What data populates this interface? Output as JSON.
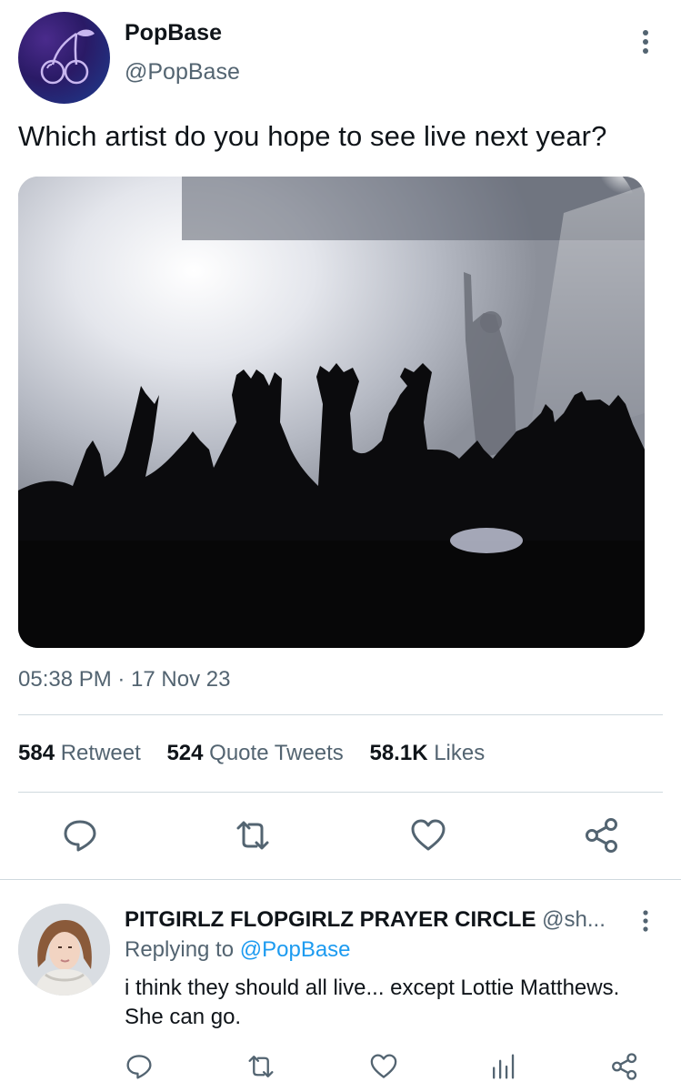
{
  "tweet": {
    "display_name": "PopBase",
    "handle": "@PopBase",
    "text": "Which artist do you hope to see live next year?",
    "timestamp": "05:38 PM · 17 Nov 23",
    "stats": {
      "retweets_count": "584",
      "retweets_label": "Retweet",
      "quotes_count": "524",
      "quotes_label": "Quote Tweets",
      "likes_count": "58.1K",
      "likes_label": "Likes"
    }
  },
  "reply": {
    "display_name": "PITGIRLZ FLOPGIRLZ PRAYER CIRCLE",
    "handle": "@sh...",
    "replying_prefix": "Replying to",
    "replying_to": "@PopBase",
    "text": "i think they should all live... except Lottie Matthews. She can go."
  },
  "icons": {
    "reply": "reply-icon",
    "retweet": "retweet-icon",
    "like": "heart-icon",
    "share": "share-icon",
    "views": "analytics-icon",
    "more": "more-vertical-icon"
  },
  "colors": {
    "text_primary": "#0f1419",
    "text_secondary": "#536471",
    "link": "#1d9bf0",
    "divider": "#cfd9de"
  }
}
